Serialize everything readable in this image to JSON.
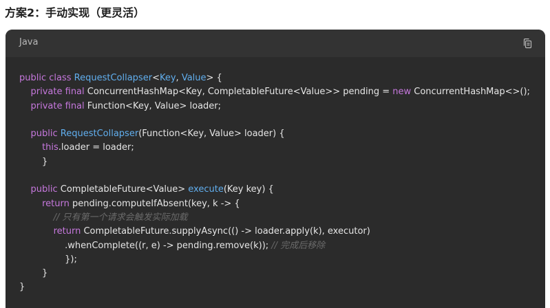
{
  "heading": {
    "title": "方案2：手动实现（更灵活）"
  },
  "code_block": {
    "language": "Java",
    "copy_icon": "copy-icon",
    "lines": [
      [
        {
          "t": "kw",
          "v": "public class "
        },
        {
          "t": "fn",
          "v": "RequestCollapser"
        },
        {
          "t": "txt",
          "v": "<"
        },
        {
          "t": "fn",
          "v": "Key"
        },
        {
          "t": "txt",
          "v": ", "
        },
        {
          "t": "fn",
          "v": "Value"
        },
        {
          "t": "txt",
          "v": "> {"
        }
      ],
      [
        {
          "t": "txt",
          "v": "    "
        },
        {
          "t": "kw",
          "v": "private final "
        },
        {
          "t": "txt",
          "v": "ConcurrentHashMap<Key, CompletableFuture<Value>> pending = "
        },
        {
          "t": "kw",
          "v": "new "
        },
        {
          "t": "txt",
          "v": "ConcurrentHashMap<>();"
        }
      ],
      [
        {
          "t": "txt",
          "v": "    "
        },
        {
          "t": "kw",
          "v": "private final "
        },
        {
          "t": "txt",
          "v": "Function<Key, Value> loader;"
        }
      ],
      [
        {
          "t": "txt",
          "v": ""
        }
      ],
      [
        {
          "t": "txt",
          "v": "    "
        },
        {
          "t": "kw",
          "v": "public "
        },
        {
          "t": "fn",
          "v": "RequestCollapser"
        },
        {
          "t": "txt",
          "v": "(Function<Key, Value> loader) {"
        }
      ],
      [
        {
          "t": "txt",
          "v": "        "
        },
        {
          "t": "kw",
          "v": "this"
        },
        {
          "t": "txt",
          "v": ".loader = loader;"
        }
      ],
      [
        {
          "t": "txt",
          "v": "        }"
        }
      ],
      [
        {
          "t": "txt",
          "v": ""
        }
      ],
      [
        {
          "t": "txt",
          "v": "    "
        },
        {
          "t": "kw",
          "v": "public "
        },
        {
          "t": "txt",
          "v": "CompletableFuture<Value> "
        },
        {
          "t": "fn",
          "v": "execute"
        },
        {
          "t": "txt",
          "v": "(Key key) {"
        }
      ],
      [
        {
          "t": "txt",
          "v": "        "
        },
        {
          "t": "kw",
          "v": "return "
        },
        {
          "t": "txt",
          "v": "pending.computeIfAbsent(key, k -> {"
        }
      ],
      [
        {
          "t": "txt",
          "v": "            "
        },
        {
          "t": "cm",
          "v": "// 只有第一个请求会触发实际加载"
        }
      ],
      [
        {
          "t": "txt",
          "v": "            "
        },
        {
          "t": "kw",
          "v": "return "
        },
        {
          "t": "txt",
          "v": "CompletableFuture.supplyAsync(() -> loader.apply(k), executor)"
        }
      ],
      [
        {
          "t": "txt",
          "v": "                .whenComplete((r, e) -> pending.remove(k)); "
        },
        {
          "t": "cm",
          "v": "// 完成后移除"
        }
      ],
      [
        {
          "t": "txt",
          "v": "                });"
        }
      ],
      [
        {
          "t": "txt",
          "v": "        }"
        }
      ],
      [
        {
          "t": "txt",
          "v": "}"
        }
      ]
    ]
  }
}
